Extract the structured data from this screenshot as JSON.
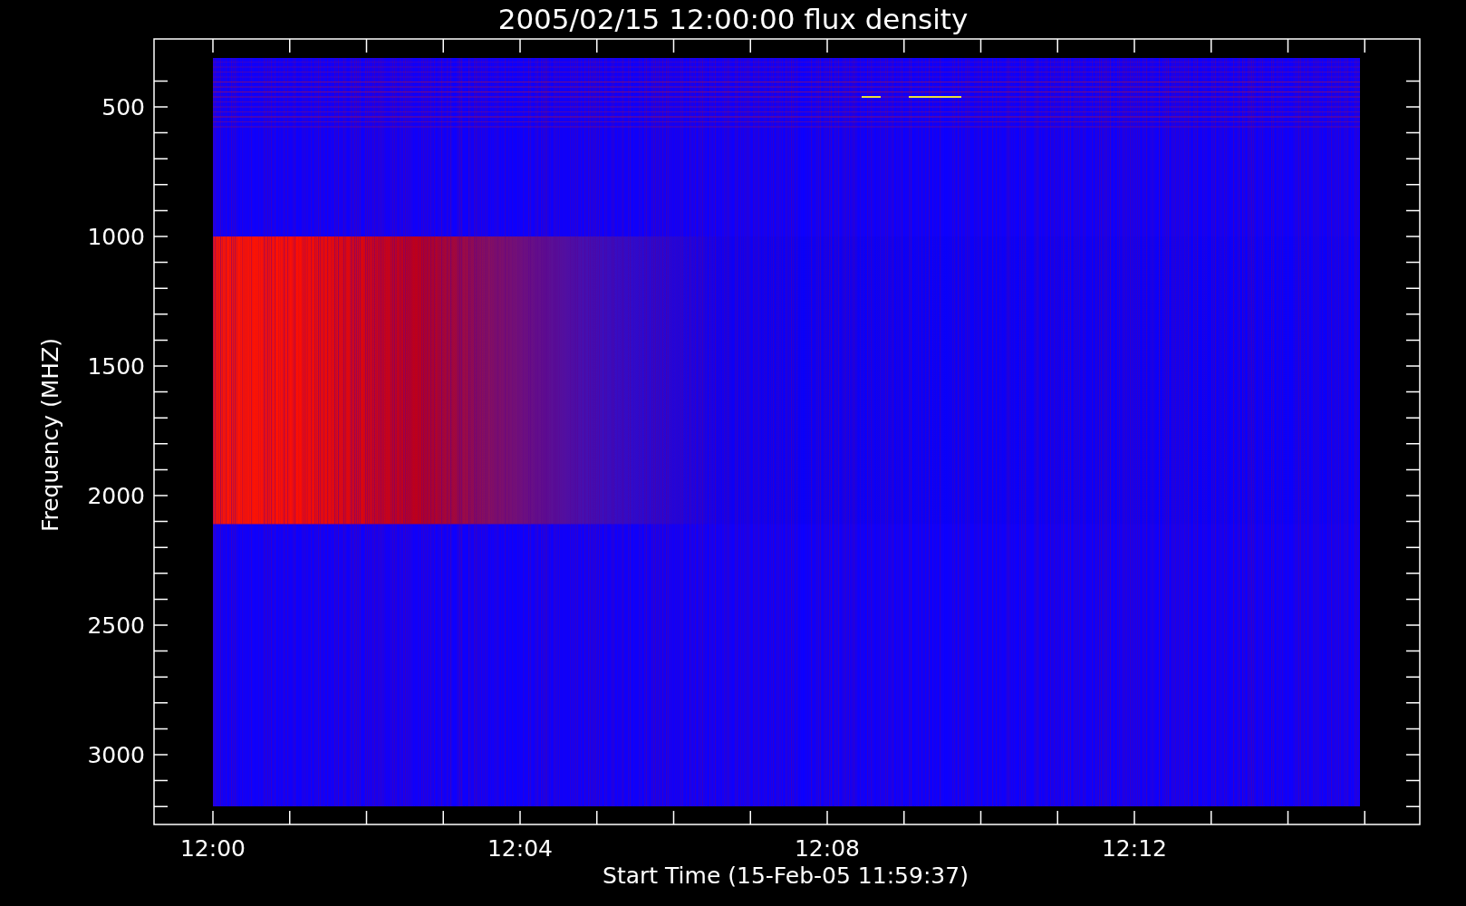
{
  "title": "2005/02/15 12:00:00 flux density",
  "y_axis": {
    "title": "Frequency (MHZ)",
    "ticks": [
      "500",
      "1000",
      "1500",
      "2000",
      "2500",
      "3000"
    ]
  },
  "x_axis": {
    "title": "Start Time (15-Feb-05 11:59:37)",
    "ticks": [
      "12:00",
      "12:04",
      "12:08",
      "12:12"
    ]
  }
}
